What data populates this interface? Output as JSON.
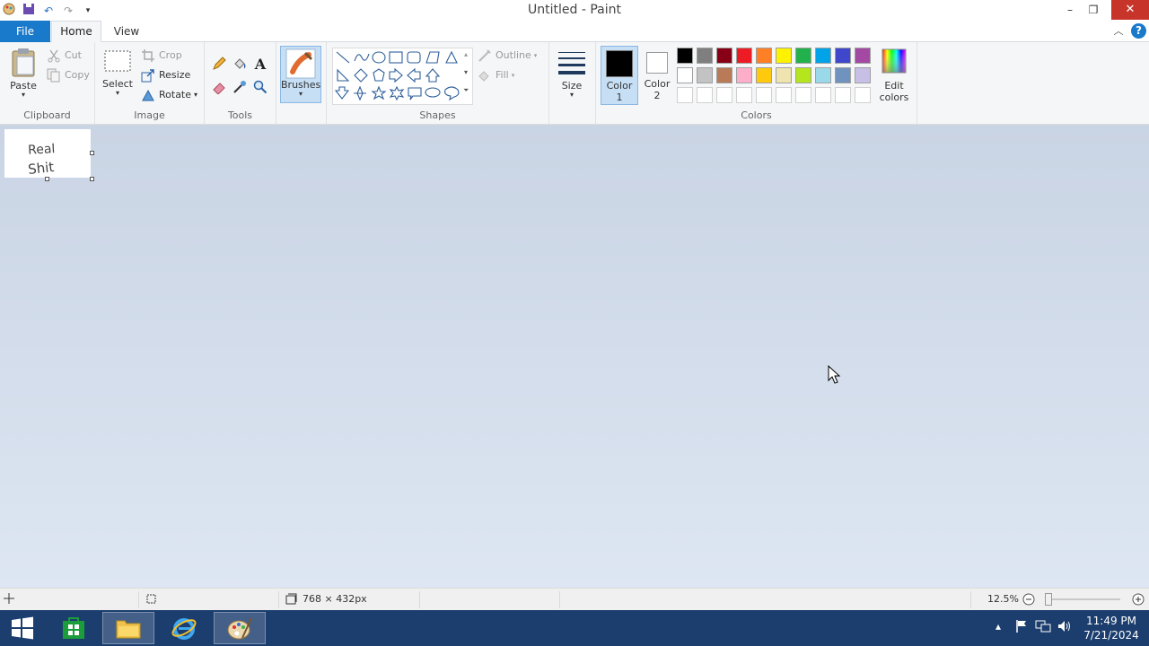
{
  "window": {
    "title": "Untitled - Paint",
    "minimize": "–",
    "maximize": "❐",
    "close": "✕"
  },
  "tabs": {
    "file": "File",
    "home": "Home",
    "view": "View"
  },
  "ribbon": {
    "clipboard": {
      "label": "Clipboard",
      "paste": "Paste",
      "cut": "Cut",
      "copy": "Copy"
    },
    "image": {
      "label": "Image",
      "select": "Select",
      "crop": "Crop",
      "resize": "Resize",
      "rotate": "Rotate"
    },
    "tools": {
      "label": "Tools"
    },
    "brushes": {
      "label": "Brushes"
    },
    "shapes": {
      "label": "Shapes",
      "outline": "Outline",
      "fill": "Fill"
    },
    "size": {
      "label": "Size"
    },
    "colors": {
      "label": "Colors",
      "color1_line1": "Color",
      "color1_line2": "1",
      "color2_line1": "Color",
      "color2_line2": "2",
      "edit_line1": "Edit",
      "edit_line2": "colors",
      "color1": "#000000",
      "color2": "#ffffff",
      "row1": [
        "#000000",
        "#7f7f7f",
        "#880015",
        "#ed1c24",
        "#ff7f27",
        "#fff200",
        "#22b14c",
        "#00a2e8",
        "#3f48cc",
        "#a349a4"
      ],
      "row2": [
        "#ffffff",
        "#c3c3c3",
        "#b97a57",
        "#ffaec9",
        "#ffc90e",
        "#efe4b0",
        "#b5e61d",
        "#99d9ea",
        "#7092be",
        "#c8bfe7"
      ]
    }
  },
  "canvas": {
    "text_line1": "Real",
    "text_line2": "Shit"
  },
  "status": {
    "image_size": "768 × 432px",
    "zoom": "12.5%"
  },
  "taskbar": {
    "time": "11:49 PM",
    "date": "7/21/2024"
  }
}
